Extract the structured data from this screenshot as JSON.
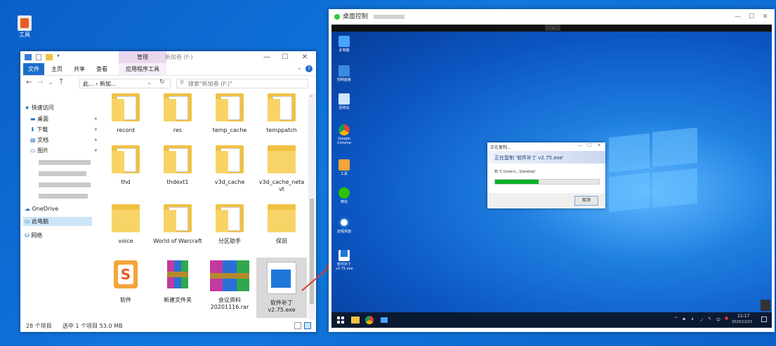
{
  "desktop": {
    "icon_label": "工具"
  },
  "explorer": {
    "title": "新加卷 (F:)",
    "context_tab": "管理",
    "ribbon_tabs": [
      "文件",
      "主页",
      "共享",
      "查看",
      "应用程序工具"
    ],
    "address": "此... › 新加...",
    "search_placeholder": "搜索\"新加卷 (F:)\"",
    "nav": {
      "quick_access": "快速访问",
      "items": [
        "桌面",
        "下载",
        "文档",
        "图片"
      ],
      "onedrive": "OneDrive",
      "this_pc": "此电脑",
      "network": "网络"
    },
    "files": [
      {
        "name": "record",
        "type": "folder"
      },
      {
        "name": "res",
        "type": "folder"
      },
      {
        "name": "temp_cache",
        "type": "folder"
      },
      {
        "name": "temppatch",
        "type": "folder"
      },
      {
        "name": "thd",
        "type": "folder"
      },
      {
        "name": "thdext1",
        "type": "folder"
      },
      {
        "name": "v3d_cache",
        "type": "folder"
      },
      {
        "name": "v3d_cache_neta vt",
        "type": "folder"
      },
      {
        "name": "voice",
        "type": "folder"
      },
      {
        "name": "World of Warcraft",
        "type": "folder"
      },
      {
        "name": "分区助手",
        "type": "folder"
      },
      {
        "name": "保旧",
        "type": "folder"
      },
      {
        "name": "软件",
        "type": "app"
      },
      {
        "name": "新建文件夹",
        "type": "archive"
      },
      {
        "name": "会议资料 20201116.rar",
        "type": "archive"
      },
      {
        "name": "软件补丁 v2.75.exe",
        "type": "exe"
      }
    ],
    "status": {
      "count": "28 个项目",
      "selected": "选中 1 个项目  53.0 MB"
    }
  },
  "remote": {
    "title": "桌面控制",
    "icons": [
      "此电脑",
      "控制面板",
      "回收站",
      "Google Chrome",
      "工具",
      "微信",
      "远程桌面",
      "软件补丁 v2.75.exe"
    ],
    "copy_dialog": {
      "title": "正在复制...",
      "heading": "正在复制 '软件补丁 v2.75.exe'",
      "from": "到 'C:\\Users\\...\\Desktop'",
      "progress": 0.42,
      "cancel": "取消"
    },
    "taskbar": {
      "time": "11:17",
      "date": "2020/12/23"
    }
  },
  "colors": {
    "accent": "#0078d7",
    "context_tab_bg": "#e9d7ef",
    "folder": "#f0c243",
    "progress": "#06b025",
    "arrow": "#e23b2e"
  }
}
